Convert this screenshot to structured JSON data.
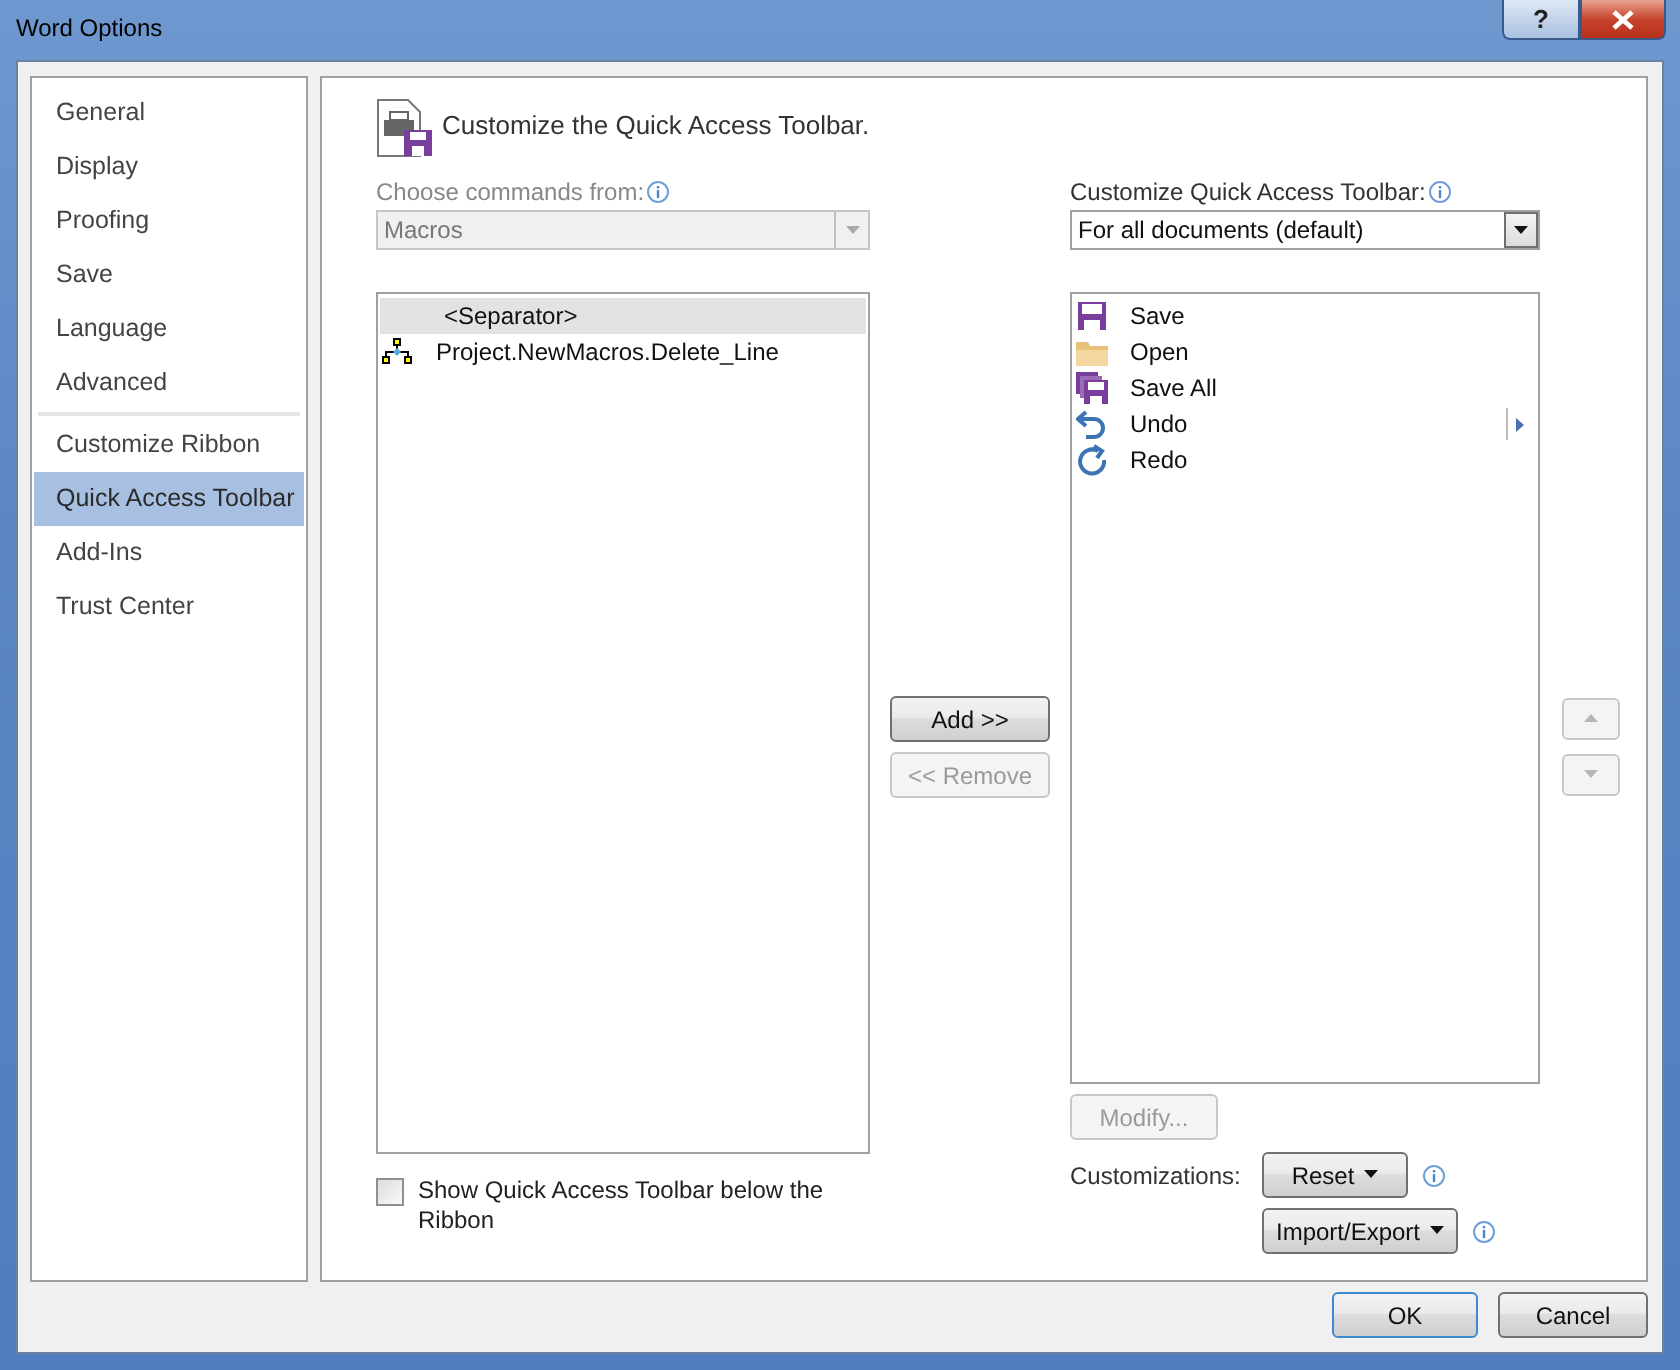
{
  "window": {
    "title": "Word Options",
    "help_button": "?"
  },
  "sidebar": {
    "groups": [
      [
        {
          "label": "General",
          "selected": false
        },
        {
          "label": "Display",
          "selected": false
        },
        {
          "label": "Proofing",
          "selected": false
        },
        {
          "label": "Save",
          "selected": false
        },
        {
          "label": "Language",
          "selected": false
        },
        {
          "label": "Advanced",
          "selected": false
        }
      ],
      [
        {
          "label": "Customize Ribbon",
          "selected": false
        },
        {
          "label": "Quick Access Toolbar",
          "selected": true
        },
        {
          "label": "Add-Ins",
          "selected": false
        },
        {
          "label": "Trust Center",
          "selected": false
        }
      ]
    ]
  },
  "header": {
    "title": "Customize the Quick Access Toolbar."
  },
  "commands": {
    "label": "Choose commands from:",
    "dropdown": {
      "value": "Macros",
      "disabled": true
    },
    "items": [
      {
        "label": "<Separator>",
        "kind": "separator",
        "selected": true
      },
      {
        "label": "Project.NewMacros.Delete_Line",
        "kind": "macro",
        "selected": false
      }
    ]
  },
  "middle_buttons": [
    {
      "label": "Add >>",
      "disabled": false
    },
    {
      "label": "<< Remove",
      "disabled": true
    }
  ],
  "toolbar": {
    "label": "Customize Quick Access Toolbar:",
    "dropdown": {
      "value": "For all documents (default)",
      "disabled": false
    },
    "items": [
      {
        "label": "Save",
        "kind": "save",
        "expandable": false
      },
      {
        "label": "Open",
        "kind": "open",
        "expandable": false
      },
      {
        "label": "Save All",
        "kind": "save_all",
        "expandable": false
      },
      {
        "label": "Undo",
        "kind": "undo",
        "expandable": true
      },
      {
        "label": "Redo",
        "kind": "redo",
        "expandable": false
      }
    ]
  },
  "move_buttons": [
    {
      "kind": "up",
      "disabled": true
    },
    {
      "kind": "down",
      "disabled": true
    }
  ],
  "modify_button": {
    "label": "Modify...",
    "disabled": true
  },
  "customizations": {
    "label": "Customizations:",
    "reset": "Reset",
    "import_export": "Import/Export"
  },
  "show_below_ribbon": {
    "label": "Show Quick Access Toolbar below the Ribbon",
    "checked": false
  },
  "footer": {
    "ok": "OK",
    "cancel": "Cancel"
  }
}
